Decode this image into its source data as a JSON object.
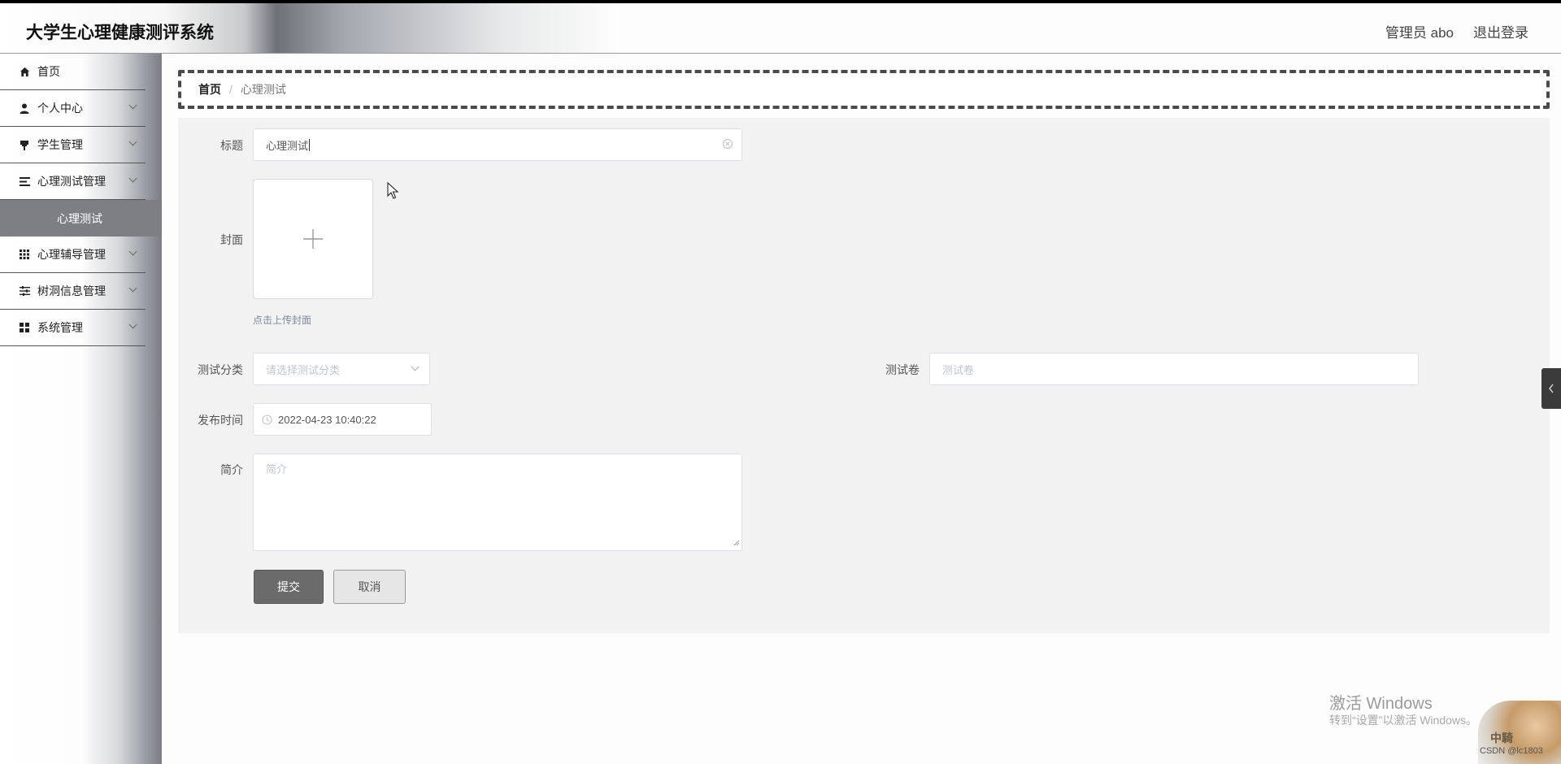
{
  "header": {
    "app_title": "大学生心理健康测评系统",
    "user_label": "管理员 abo",
    "logout_label": "退出登录"
  },
  "sidebar": {
    "items": [
      {
        "label": "首页",
        "icon": "home-icon"
      },
      {
        "label": "个人中心",
        "icon": "user-icon"
      },
      {
        "label": "学生管理",
        "icon": "pin-icon"
      },
      {
        "label": "心理测试管理",
        "icon": "list-icon"
      },
      {
        "label": "心理辅导管理",
        "icon": "grid-icon"
      },
      {
        "label": "树洞信息管理",
        "icon": "sliders-icon"
      },
      {
        "label": "系统管理",
        "icon": "dashboard-icon"
      }
    ],
    "active_sub": "心理测试"
  },
  "breadcrumb": {
    "home": "首页",
    "separator": "/",
    "current": "心理测试"
  },
  "form": {
    "title_label": "标题",
    "title_value": "心理测试",
    "cover_label": "封面",
    "cover_hint": "点击上传封面",
    "category_label": "测试分类",
    "category_placeholder": "请选择测试分类",
    "paper_label": "测试卷",
    "paper_placeholder": "测试卷",
    "publish_label": "发布时间",
    "publish_value": "2022-04-23 10:40:22",
    "intro_label": "简介",
    "intro_placeholder": "简介",
    "submit_label": "提交",
    "cancel_label": "取消"
  },
  "watermark": {
    "title": "激活 Windows",
    "subtitle": "转到“设置”以激活 Windows。",
    "avatar_text": "中騎",
    "csdn_text": "CSDN @lc1803"
  },
  "colors": {
    "active_menu_bg": "#7d7f84",
    "submit_bg": "#6b6b6b",
    "panel_bg": "#f2f2f2"
  }
}
